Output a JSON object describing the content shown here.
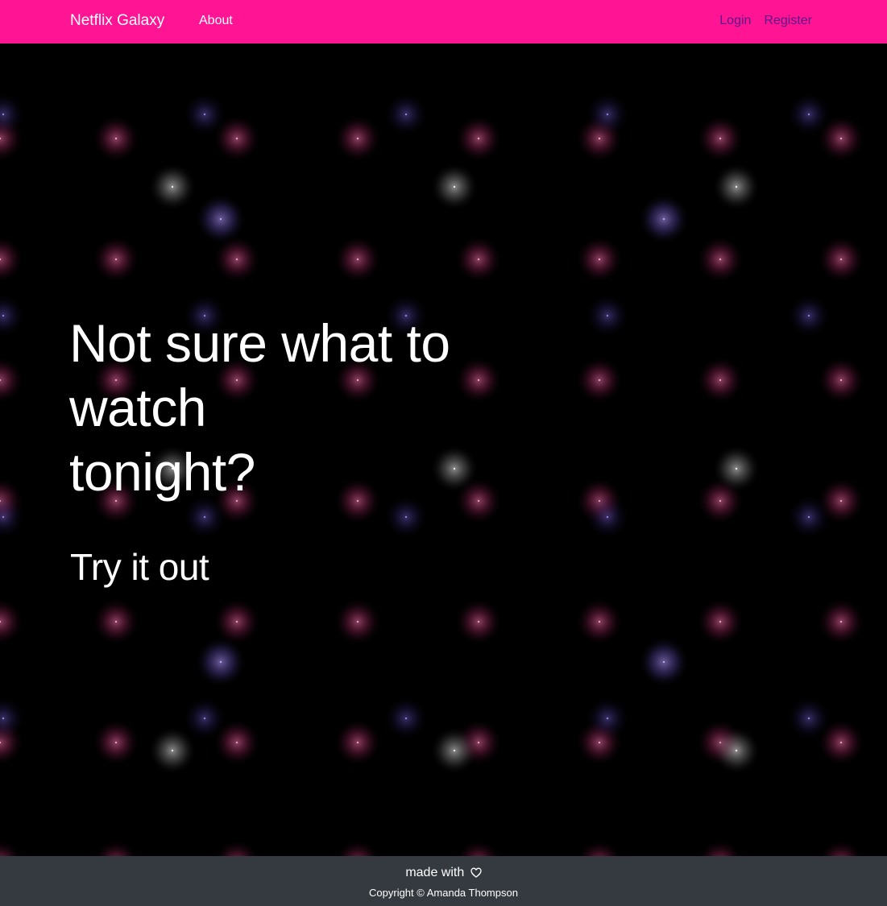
{
  "navbar": {
    "brand": "Netflix Galaxy",
    "about_label": "About",
    "login_label": "Login",
    "register_label": "Register",
    "background_color": "#ff1493",
    "right_link_color": "#5a1a8a"
  },
  "hero": {
    "headline_lines": [
      "Not sure what to",
      "watch",
      "tonight?"
    ],
    "cta_label": "Try it out",
    "background_color": "#000000",
    "star_colors": {
      "pink": "#ff5aa0",
      "purple": "#9a7cff",
      "white": "#e8e8e8",
      "indigo": "#5a4aa8"
    }
  },
  "footer": {
    "made_with": "made with",
    "heart_icon": "heart-outline-icon",
    "copyright": "Copyright © Amanda Thompson",
    "background_color": "#343a40"
  }
}
